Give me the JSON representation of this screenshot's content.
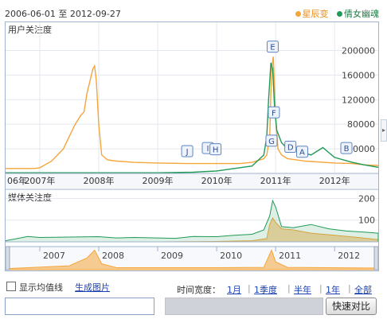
{
  "header": {
    "date_range": "2006-06-01 至 2012-09-27",
    "legend": [
      {
        "label": "星辰变",
        "color": "#f5a53a"
      },
      {
        "label": "倩女幽魂",
        "color": "#1f9a57"
      }
    ]
  },
  "panels": {
    "user_title": "用户关注度",
    "media_title": "媒体关注度"
  },
  "chart_data": [
    {
      "type": "line",
      "title": "用户关注度",
      "x_tick_labels": [
        "06年",
        "2007年",
        "2008年",
        "2009年",
        "2010年",
        "2011年",
        "2012年"
      ],
      "y_tick_labels": [
        "200000",
        "160000",
        "120000",
        "80000",
        "40000"
      ],
      "ylim": [
        0,
        220000
      ],
      "x_range": [
        2006.42,
        2012.74
      ],
      "grid": true,
      "series": [
        {
          "name": "星辰变",
          "color": "#f5a53a",
          "x": [
            2006.42,
            2006.9,
            2007.0,
            2007.2,
            2007.4,
            2007.5,
            2007.6,
            2007.7,
            2007.75,
            2007.8,
            2007.85,
            2007.9,
            2007.93,
            2007.96,
            2008.0,
            2008.05,
            2008.15,
            2008.3,
            2008.6,
            2009.0,
            2009.5,
            2010.0,
            2010.4,
            2010.6,
            2010.8,
            2010.85,
            2010.9,
            2010.93,
            2010.96,
            2011.0,
            2011.04,
            2011.1,
            2011.2,
            2011.5,
            2012.0,
            2012.3,
            2012.5,
            2012.74
          ],
          "y": [
            8000,
            8000,
            9000,
            20000,
            40000,
            60000,
            80000,
            95000,
            100000,
            130000,
            150000,
            170000,
            175000,
            150000,
            80000,
            30000,
            22000,
            20000,
            18000,
            17000,
            16000,
            16000,
            16000,
            18000,
            24000,
            30000,
            60000,
            170000,
            190000,
            90000,
            40000,
            30000,
            24000,
            20000,
            17000,
            16000,
            14000,
            13000
          ]
        },
        {
          "name": "倩女幽魂",
          "color": "#1f9a57",
          "x": [
            2006.42,
            2007.0,
            2008.0,
            2009.0,
            2009.6,
            2010.0,
            2010.3,
            2010.6,
            2010.8,
            2010.85,
            2010.88,
            2010.92,
            2010.95,
            2010.98,
            2011.02,
            2011.1,
            2011.2,
            2011.4,
            2011.6,
            2011.8,
            2012.0,
            2012.3,
            2012.5,
            2012.74
          ],
          "y": [
            1000,
            1000,
            1000,
            1000,
            2000,
            4000,
            8000,
            12000,
            30000,
            60000,
            120000,
            180000,
            170000,
            110000,
            70000,
            50000,
            40000,
            36000,
            30000,
            42000,
            26000,
            18000,
            14000,
            10000
          ]
        }
      ]
    },
    {
      "type": "area",
      "title": "媒体关注度",
      "y_tick_labels": [
        "200",
        "100"
      ],
      "ylim": [
        0,
        220
      ],
      "x_range": [
        2006.42,
        2012.74
      ],
      "series": [
        {
          "name": "星辰变",
          "color": "#f5a53a",
          "x": [
            2006.42,
            2008.0,
            2009.0,
            2010.0,
            2010.6,
            2010.85,
            2010.9,
            2010.95,
            2011.0,
            2011.1,
            2011.3,
            2011.6,
            2012.0,
            2012.4,
            2012.74
          ],
          "y": [
            0,
            0,
            0,
            2,
            5,
            15,
            80,
            110,
            90,
            60,
            55,
            40,
            30,
            20,
            10
          ]
        },
        {
          "name": "倩女幽魂",
          "color": "#1f9a57",
          "x": [
            2006.42,
            2006.8,
            2007.0,
            2007.5,
            2008.0,
            2008.3,
            2008.6,
            2009.0,
            2009.3,
            2009.6,
            2010.0,
            2010.3,
            2010.6,
            2010.8,
            2010.9,
            2010.95,
            2011.0,
            2011.1,
            2011.3,
            2011.6,
            2011.9,
            2012.2,
            2012.5,
            2012.74
          ],
          "y": [
            5,
            25,
            20,
            22,
            24,
            18,
            20,
            18,
            16,
            25,
            24,
            30,
            35,
            55,
            120,
            190,
            160,
            70,
            65,
            80,
            60,
            50,
            45,
            40
          ]
        }
      ]
    },
    {
      "type": "area",
      "title": "",
      "x_tick_labels": [
        "2007",
        "2008",
        "2009",
        "2010",
        "2011",
        "2012"
      ],
      "x_range": [
        2006.42,
        2012.74
      ],
      "series": [
        {
          "name": "星辰变",
          "color": "#f5a53a",
          "x": [
            2006.42,
            2007.5,
            2007.8,
            2007.93,
            2008.05,
            2008.3,
            2010.0,
            2010.8,
            2010.93,
            2011.0,
            2011.2,
            2012.74
          ],
          "y": [
            5,
            20,
            60,
            100,
            30,
            10,
            10,
            12,
            100,
            40,
            12,
            8
          ]
        }
      ]
    }
  ],
  "event_markers": [
    "J",
    "I",
    "H",
    "E",
    "F",
    "G",
    "D",
    "A",
    "B"
  ],
  "controls": {
    "show_avg_label": "显示均值线",
    "generate_image": "生成图片",
    "time_width_label": "时间宽度：",
    "time_options": [
      "1月",
      "1季度",
      "半年",
      "1年",
      "全部"
    ],
    "compare_button": "快速对比"
  }
}
